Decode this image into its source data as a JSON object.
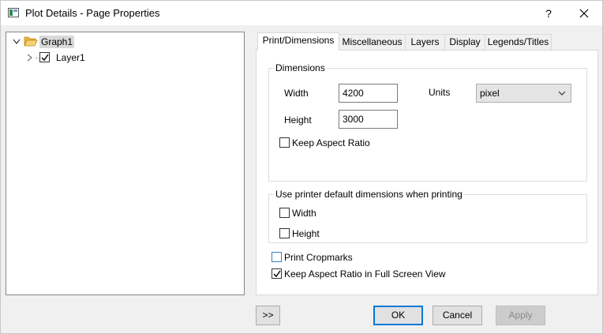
{
  "window": {
    "title": "Plot Details - Page Properties",
    "help_label": "?"
  },
  "tree": {
    "root_label": "Graph1",
    "child_label": "Layer1",
    "child_checked": true
  },
  "tabs": [
    {
      "label": "Print/Dimensions",
      "active": true
    },
    {
      "label": "Miscellaneous",
      "active": false
    },
    {
      "label": "Layers",
      "active": false
    },
    {
      "label": "Display",
      "active": false
    },
    {
      "label": "Legends/Titles",
      "active": false
    }
  ],
  "dimensions": {
    "group_title": "Dimensions",
    "width_label": "Width",
    "width_value": "4200",
    "height_label": "Height",
    "height_value": "3000",
    "units_label": "Units",
    "units_value": "pixel",
    "keep_aspect_label": "Keep Aspect Ratio",
    "keep_aspect_checked": false
  },
  "printer": {
    "group_title": "Use printer default dimensions when printing",
    "width_label": "Width",
    "width_checked": false,
    "height_label": "Height",
    "height_checked": false
  },
  "options": {
    "cropmarks_label": "Print Cropmarks",
    "cropmarks_checked": false,
    "fullscreen_label": "Keep Aspect Ratio in Full Screen View",
    "fullscreen_checked": true
  },
  "buttons": {
    "expand_label": ">>",
    "ok_label": "OK",
    "cancel_label": "Cancel",
    "apply_label": "Apply",
    "apply_enabled": false
  }
}
